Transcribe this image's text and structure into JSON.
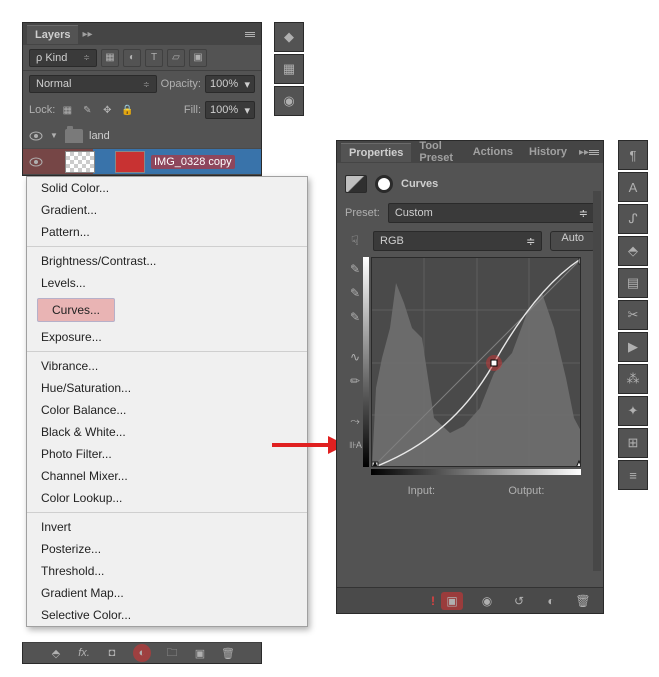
{
  "layers_panel": {
    "tab": "Layers",
    "kind_label": "Kind",
    "blend_mode": "Normal",
    "opacity_label": "Opacity:",
    "opacity_value": "100%",
    "lock_label": "Lock:",
    "fill_label": "Fill:",
    "fill_value": "100%",
    "group_name": "land",
    "selected_layer": "IMG_0328 copy"
  },
  "adjustment_menu": {
    "items_a": [
      "Solid Color...",
      "Gradient...",
      "Pattern..."
    ],
    "items_b": [
      "Brightness/Contrast...",
      "Levels..."
    ],
    "highlight": "Curves...",
    "items_b2": [
      "Exposure..."
    ],
    "items_c": [
      "Vibrance...",
      "Hue/Saturation...",
      "Color Balance...",
      "Black & White...",
      "Photo Filter...",
      "Channel Mixer...",
      "Color Lookup..."
    ],
    "items_d": [
      "Invert",
      "Posterize...",
      "Threshold...",
      "Gradient Map...",
      "Selective Color..."
    ]
  },
  "properties_panel": {
    "tabs": [
      "Properties",
      "Tool Preset",
      "Actions",
      "History"
    ],
    "title": "Curves",
    "preset_label": "Preset:",
    "preset_value": "Custom",
    "channel_value": "RGB",
    "auto_label": "Auto",
    "input_label": "Input:",
    "output_label": "Output:"
  },
  "chart_data": {
    "type": "line",
    "title": "Curves",
    "xlabel": "Input",
    "ylabel": "Output",
    "xlim": [
      0,
      255
    ],
    "ylim": [
      0,
      255
    ],
    "series": [
      {
        "name": "baseline",
        "x": [
          0,
          255
        ],
        "y": [
          0,
          255
        ]
      },
      {
        "name": "curve",
        "x": [
          0,
          64,
          128,
          192,
          255
        ],
        "y": [
          0,
          40,
          105,
          190,
          255
        ]
      }
    ],
    "control_point": {
      "x": 148,
      "y": 128
    },
    "histogram_peaks_x": [
      10,
      28,
      48,
      92,
      150,
      200,
      245
    ],
    "histogram_peaks_h": [
      110,
      185,
      140,
      52,
      95,
      170,
      58
    ]
  }
}
